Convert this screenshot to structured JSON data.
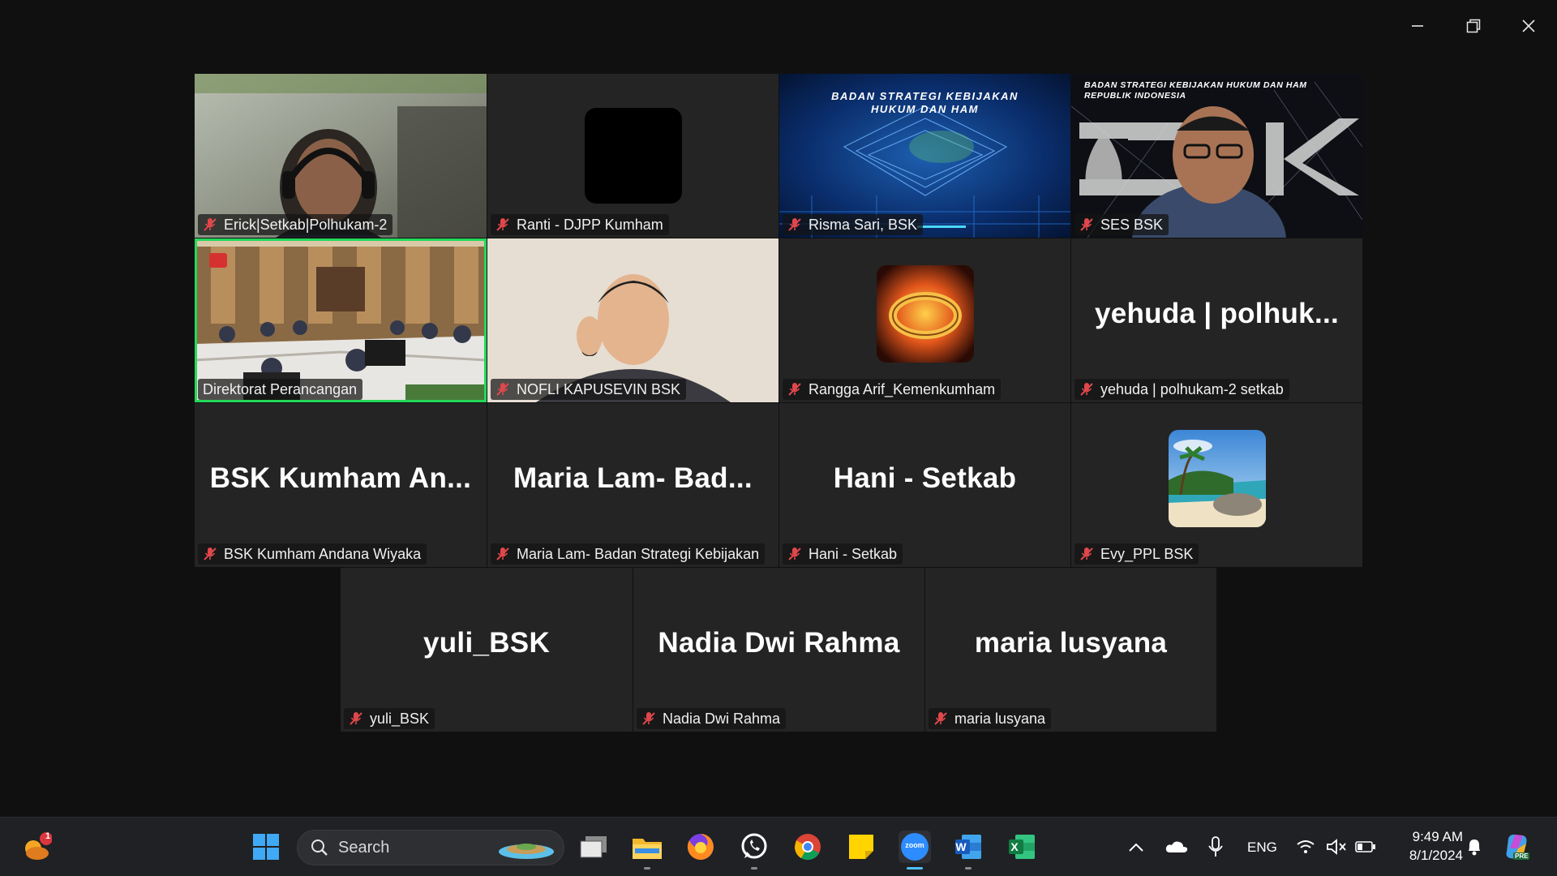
{
  "window": {
    "controls": [
      "minimize-icon",
      "restore-icon",
      "close-icon"
    ]
  },
  "gallery": {
    "tiles": [
      {
        "id": "erick",
        "label": "Erick|Setkab|Polhukam-2",
        "video": true,
        "muted": true
      },
      {
        "id": "ranti",
        "label": "Ranti - DJPP Kumham",
        "video": false,
        "muted": true
      },
      {
        "id": "risma",
        "label": "Risma Sari, BSK",
        "video": true,
        "muted": true,
        "overlay_line1": "BADAN STRATEGI KEBIJAKAN",
        "overlay_line2": "HUKUM DAN HAM"
      },
      {
        "id": "ses",
        "label": "SES BSK",
        "video": true,
        "muted": true,
        "overlay_line1": "BADAN STRATEGI KEBIJAKAN HUKUM DAN HAM",
        "overlay_line2": "REPUBLIK INDONESIA"
      },
      {
        "id": "direktorat",
        "label": "Direktorat Perancangan",
        "video": true,
        "muted": false,
        "active_speaker": true
      },
      {
        "id": "nofli",
        "label": "NOFLI KAPUSEVIN BSK",
        "video": true,
        "muted": true
      },
      {
        "id": "rangga",
        "label": "Rangga Arif_Kemenkumham",
        "video": false,
        "muted": true
      },
      {
        "id": "yehuda",
        "label": "yehuda | polhukam-2 setkab",
        "name_display": "yehuda | polhuk...",
        "video": false,
        "muted": true
      },
      {
        "id": "andana",
        "label": "BSK Kumham Andana Wiyaka",
        "name_display": "BSK Kumham An...",
        "video": false,
        "muted": true
      },
      {
        "id": "maria-lam",
        "label": "Maria Lam- Badan Strategi Kebijakan",
        "name_display": "Maria Lam- Bad...",
        "video": false,
        "muted": true
      },
      {
        "id": "hani",
        "label": "Hani - Setkab",
        "name_display": "Hani - Setkab",
        "video": false,
        "muted": true
      },
      {
        "id": "evy",
        "label": "Evy_PPL BSK",
        "video": false,
        "muted": true
      },
      {
        "id": "yuli",
        "label": "yuli_BSK",
        "name_display": "yuli_BSK",
        "video": false,
        "muted": true
      },
      {
        "id": "nadia",
        "label": "Nadia Dwi Rahma",
        "name_display": "Nadia Dwi Rahma",
        "video": false,
        "muted": true
      },
      {
        "id": "maria-lusyana",
        "label": "maria lusyana",
        "name_display": "maria lusyana",
        "video": false,
        "muted": true
      }
    ]
  },
  "taskbar": {
    "widget_badge": "1",
    "search_placeholder": "Search",
    "zoom_label": "zoom",
    "word_letter": "W",
    "excel_letter": "X",
    "language": "ENG",
    "time": "9:49 AM",
    "date": "8/1/2024",
    "copilot_badge": "PRE",
    "pinned": [
      "start-icon",
      "task-view-icon",
      "file-explorer-icon",
      "firefox-icon",
      "whatsapp-icon",
      "chrome-icon",
      "sticky-notes-icon",
      "zoom-icon",
      "word-icon",
      "excel-icon"
    ],
    "tray": [
      "chevron-up-icon",
      "onedrive-icon",
      "microphone-icon",
      "wifi-icon",
      "speaker-muted-icon",
      "battery-icon",
      "notification-bell-icon",
      "copilot-icon"
    ]
  },
  "colors": {
    "active_speaker": "#23d959",
    "tile_bg": "#242424",
    "mute": "#e0474c",
    "taskbar_bg": "#202124"
  }
}
